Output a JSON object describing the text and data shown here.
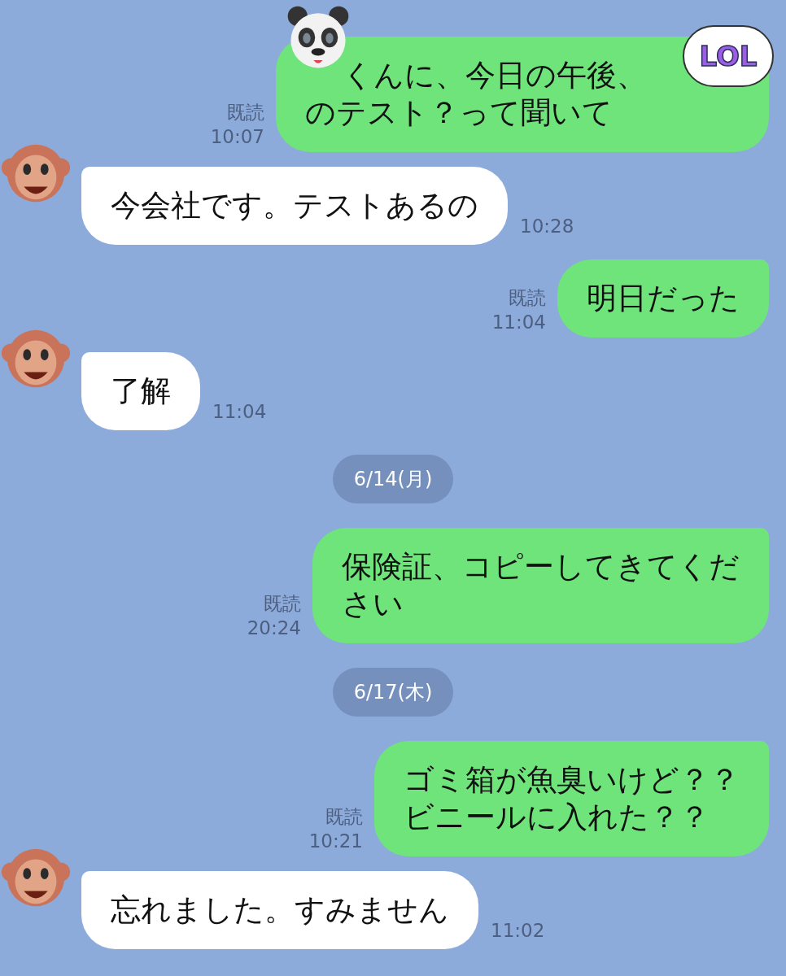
{
  "messages": [
    {
      "kind": "sent",
      "lines": [
        "くんに、今日の午後、",
        "のテスト？って聞いて"
      ],
      "read_label": "既読",
      "time": "10:07",
      "stickers": [
        {
          "kind": "panda"
        },
        {
          "kind": "lol",
          "text": "LOL"
        }
      ]
    },
    {
      "kind": "received",
      "lines": [
        "今会社です。テストあるの"
      ],
      "time": "10:28"
    },
    {
      "kind": "sent",
      "lines": [
        "明日だった"
      ],
      "read_label": "既読",
      "time": "11:04"
    },
    {
      "kind": "received",
      "lines": [
        "了解"
      ],
      "time": "11:04"
    },
    {
      "kind": "date",
      "label": "6/14(月)"
    },
    {
      "kind": "sent",
      "lines": [
        "保険証、コピーしてきてくだ",
        "さい"
      ],
      "read_label": "既読",
      "time": "20:24"
    },
    {
      "kind": "date",
      "label": "6/17(木)"
    },
    {
      "kind": "sent",
      "lines": [
        "ゴミ箱が魚臭いけど？？",
        "ビニールに入れた？？"
      ],
      "read_label": "既読",
      "time": "10:21"
    },
    {
      "kind": "received",
      "lines": [
        "忘れました。すみません"
      ],
      "time": "11:02"
    }
  ]
}
